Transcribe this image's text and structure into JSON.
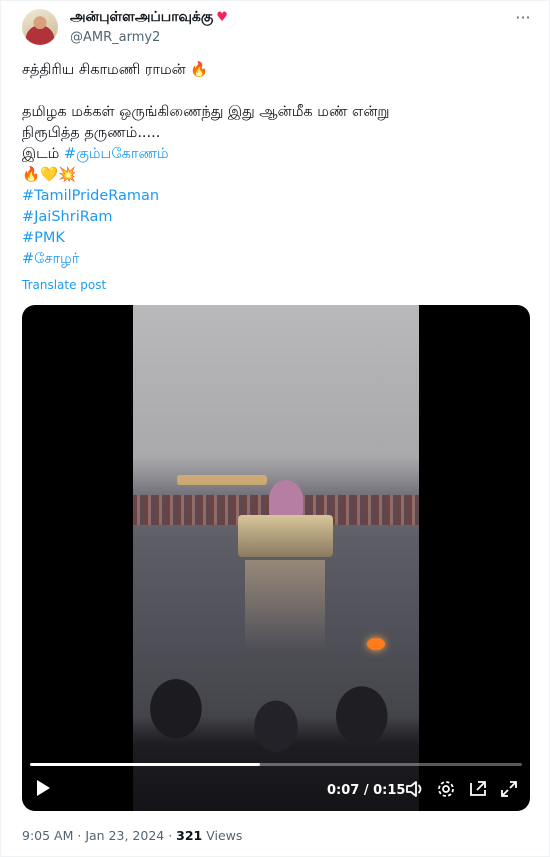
{
  "author": {
    "display_name": "அன்புள்ளஅப்பாவுக்கு",
    "handle": "@AMR_army2"
  },
  "icons": {
    "heart": "heart-icon",
    "more": "more-icon",
    "play": "play-icon",
    "volume": "volume-icon",
    "settings": "settings-icon",
    "pip": "picture-in-picture-icon",
    "fullscreen": "fullscreen-icon"
  },
  "tweet": {
    "line1": "சத்திரிய சிகாமணி ராமன் 🔥",
    "line2": "தமிழக மக்கள் ஒருங்கிணைந்து இது ஆன்மீக மண் என்று",
    "line3": "நிரூபித்த தருணம்.....",
    "place_prefix": "இடம் ",
    "place_tag": "#கும்பகோணம்",
    "emojis": "🔥💛💥",
    "hashtags": [
      "#TamilPrideRaman",
      "#JaiShriRam",
      "#PMK",
      "#சோழர்"
    ],
    "translate_label": "Translate post"
  },
  "video": {
    "current_time": "0:07",
    "total_time": "0:15",
    "time_display": "0:07 / 0:15",
    "progress": 0.467
  },
  "footer": {
    "time": "9:05 AM",
    "date": "Jan 23, 2024",
    "views_count": "321",
    "views_label": "Views"
  },
  "colors": {
    "link": "#1d9bf0",
    "secondary_text": "#536471",
    "heart": "#f4245e"
  }
}
